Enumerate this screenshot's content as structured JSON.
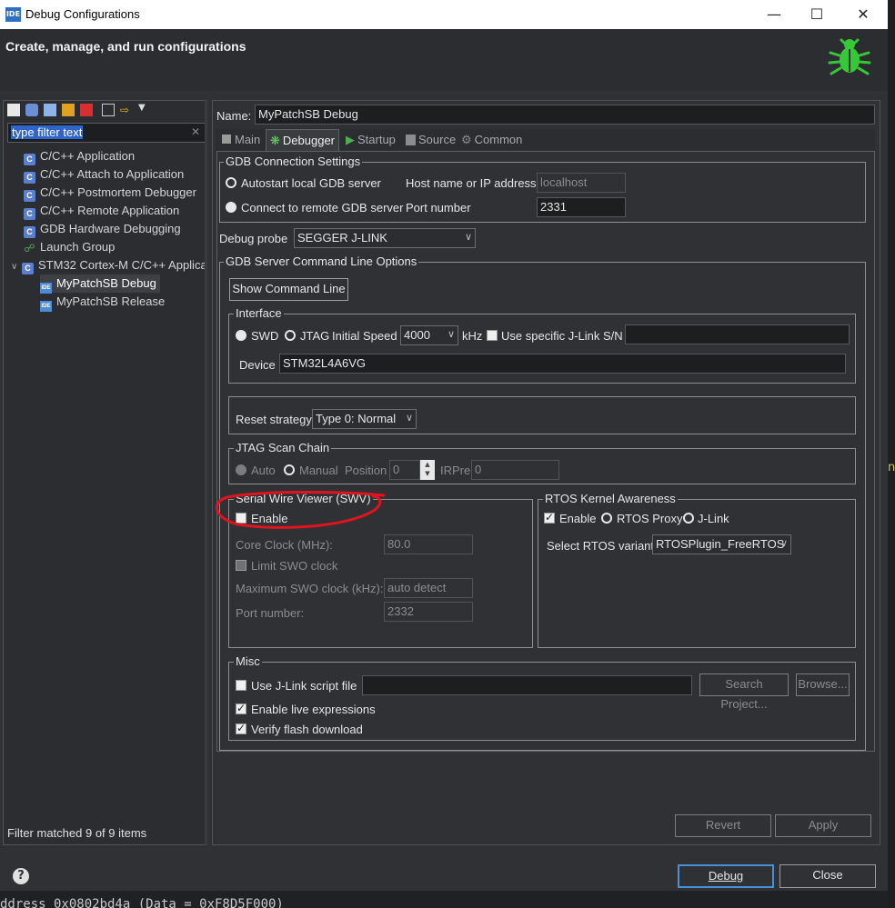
{
  "window": {
    "title": "Debug Configurations",
    "app_icon": "IDE"
  },
  "header": {
    "title": "Create, manage, and run configurations"
  },
  "left": {
    "filter_placeholder": "type filter text",
    "tree": [
      {
        "label": "C/C++ Application"
      },
      {
        "label": "C/C++ Attach to Application"
      },
      {
        "label": "C/C++ Postmortem Debugger"
      },
      {
        "label": "C/C++ Remote Application"
      },
      {
        "label": "GDB Hardware Debugging"
      },
      {
        "label": "Launch Group"
      },
      {
        "label": "STM32 Cortex-M C/C++ Applica"
      },
      {
        "label": "MyPatchSB Debug"
      },
      {
        "label": "MyPatchSB Release"
      }
    ],
    "status": "Filter matched 9 of 9 items"
  },
  "config": {
    "name_label": "Name:",
    "name_value": "MyPatchSB Debug",
    "tabs": [
      "Main",
      "Debugger",
      "Startup",
      "Source",
      "Common"
    ],
    "gdb": {
      "title": "GDB Connection Settings",
      "autostart": "Autostart local GDB server",
      "remote": "Connect to remote GDB server",
      "host_label": "Host name or IP address",
      "host_value": "localhost",
      "port_label": "Port number",
      "port_value": "2331"
    },
    "probe_label": "Debug probe",
    "probe_value": "SEGGER J-LINK",
    "server": {
      "title": "GDB Server Command Line Options",
      "show_cmd": "Show Command Line"
    },
    "interface": {
      "title": "Interface",
      "swd": "SWD",
      "jtag": "JTAG",
      "speed_label": "Initial Speed",
      "speed_value": "4000",
      "khz": "kHz",
      "specific": "Use specific J-Link S/N",
      "device_label": "Device",
      "device_value": "STM32L4A6VG"
    },
    "reset": {
      "label": "Reset strategy",
      "value": "Type 0: Normal"
    },
    "jtag_chain": {
      "title": "JTAG Scan Chain",
      "auto": "Auto",
      "manual": "Manual",
      "position": "Position",
      "position_value": "0",
      "irpre": "IRPre",
      "irpre_value": "0"
    },
    "swv": {
      "title": "Serial Wire Viewer (SWV)",
      "enable": "Enable",
      "core_clock": "Core Clock (MHz):",
      "core_clock_value": "80.0",
      "limit": "Limit SWO clock",
      "max_swo": "Maximum SWO clock (kHz):",
      "max_swo_value": "auto detect",
      "port": "Port number:",
      "port_value": "2332"
    },
    "rtos": {
      "title": "RTOS Kernel Awareness",
      "enable": "Enable",
      "proxy": "RTOS Proxy",
      "jlink": "J-Link",
      "variant_label": "Select RTOS variant:",
      "variant_value": "RTOSPlugin_FreeRTOS"
    },
    "misc": {
      "title": "Misc",
      "script": "Use J-Link script file",
      "search": "Search Project...",
      "browse": "Browse...",
      "live": "Enable live expressions",
      "verify": "Verify flash download"
    },
    "revert": "Revert",
    "apply": "Apply"
  },
  "footer": {
    "debug": "Debug",
    "close": "Close"
  },
  "console_text": "ddress 0x0802bd4a (Data = 0xF8D5F000)",
  "colors": {
    "accent_annotation": "#e0141e",
    "bug": "#37c837",
    "selection": "#2f65ca"
  }
}
